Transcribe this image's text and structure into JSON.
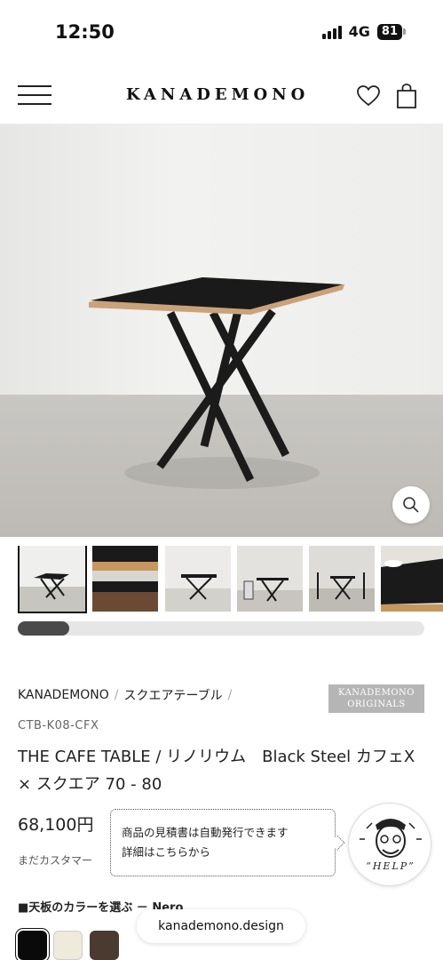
{
  "status_bar": {
    "time": "12:50",
    "network": "4G",
    "battery": "81"
  },
  "header": {
    "logo": "KANADEMONO"
  },
  "breadcrumb": {
    "items": [
      "KANADEMONO",
      "スクエアテーブル"
    ]
  },
  "badge": {
    "line1": "KANADEMONO",
    "line2": "ORIGINALS"
  },
  "product": {
    "sku": "CTB-K08-CFX",
    "title": "THE CAFE TABLE / リノリウム　Black Steel カフェX × スクエア 70 - 80",
    "price": "68,100円",
    "customer_note": "まだカスタマー"
  },
  "help": {
    "tooltip_line1": "商品の見積書は自動発行できます",
    "tooltip_line2": "詳細はこちらから",
    "avatar_label": "“HELP”"
  },
  "color_selector": {
    "label": "■天板のカラーを選ぶ － Nero",
    "swatches": [
      "#0a0a0a",
      "#eeeadc",
      "#4a3a30"
    ]
  },
  "browser": {
    "url": "kanademono.design"
  },
  "colors": {
    "accent": "#111111",
    "scroll_thumb": "#4a4a4a",
    "badge_bg": "#b5b5b5"
  },
  "gallery": {
    "scroll_progress": 0.12
  }
}
